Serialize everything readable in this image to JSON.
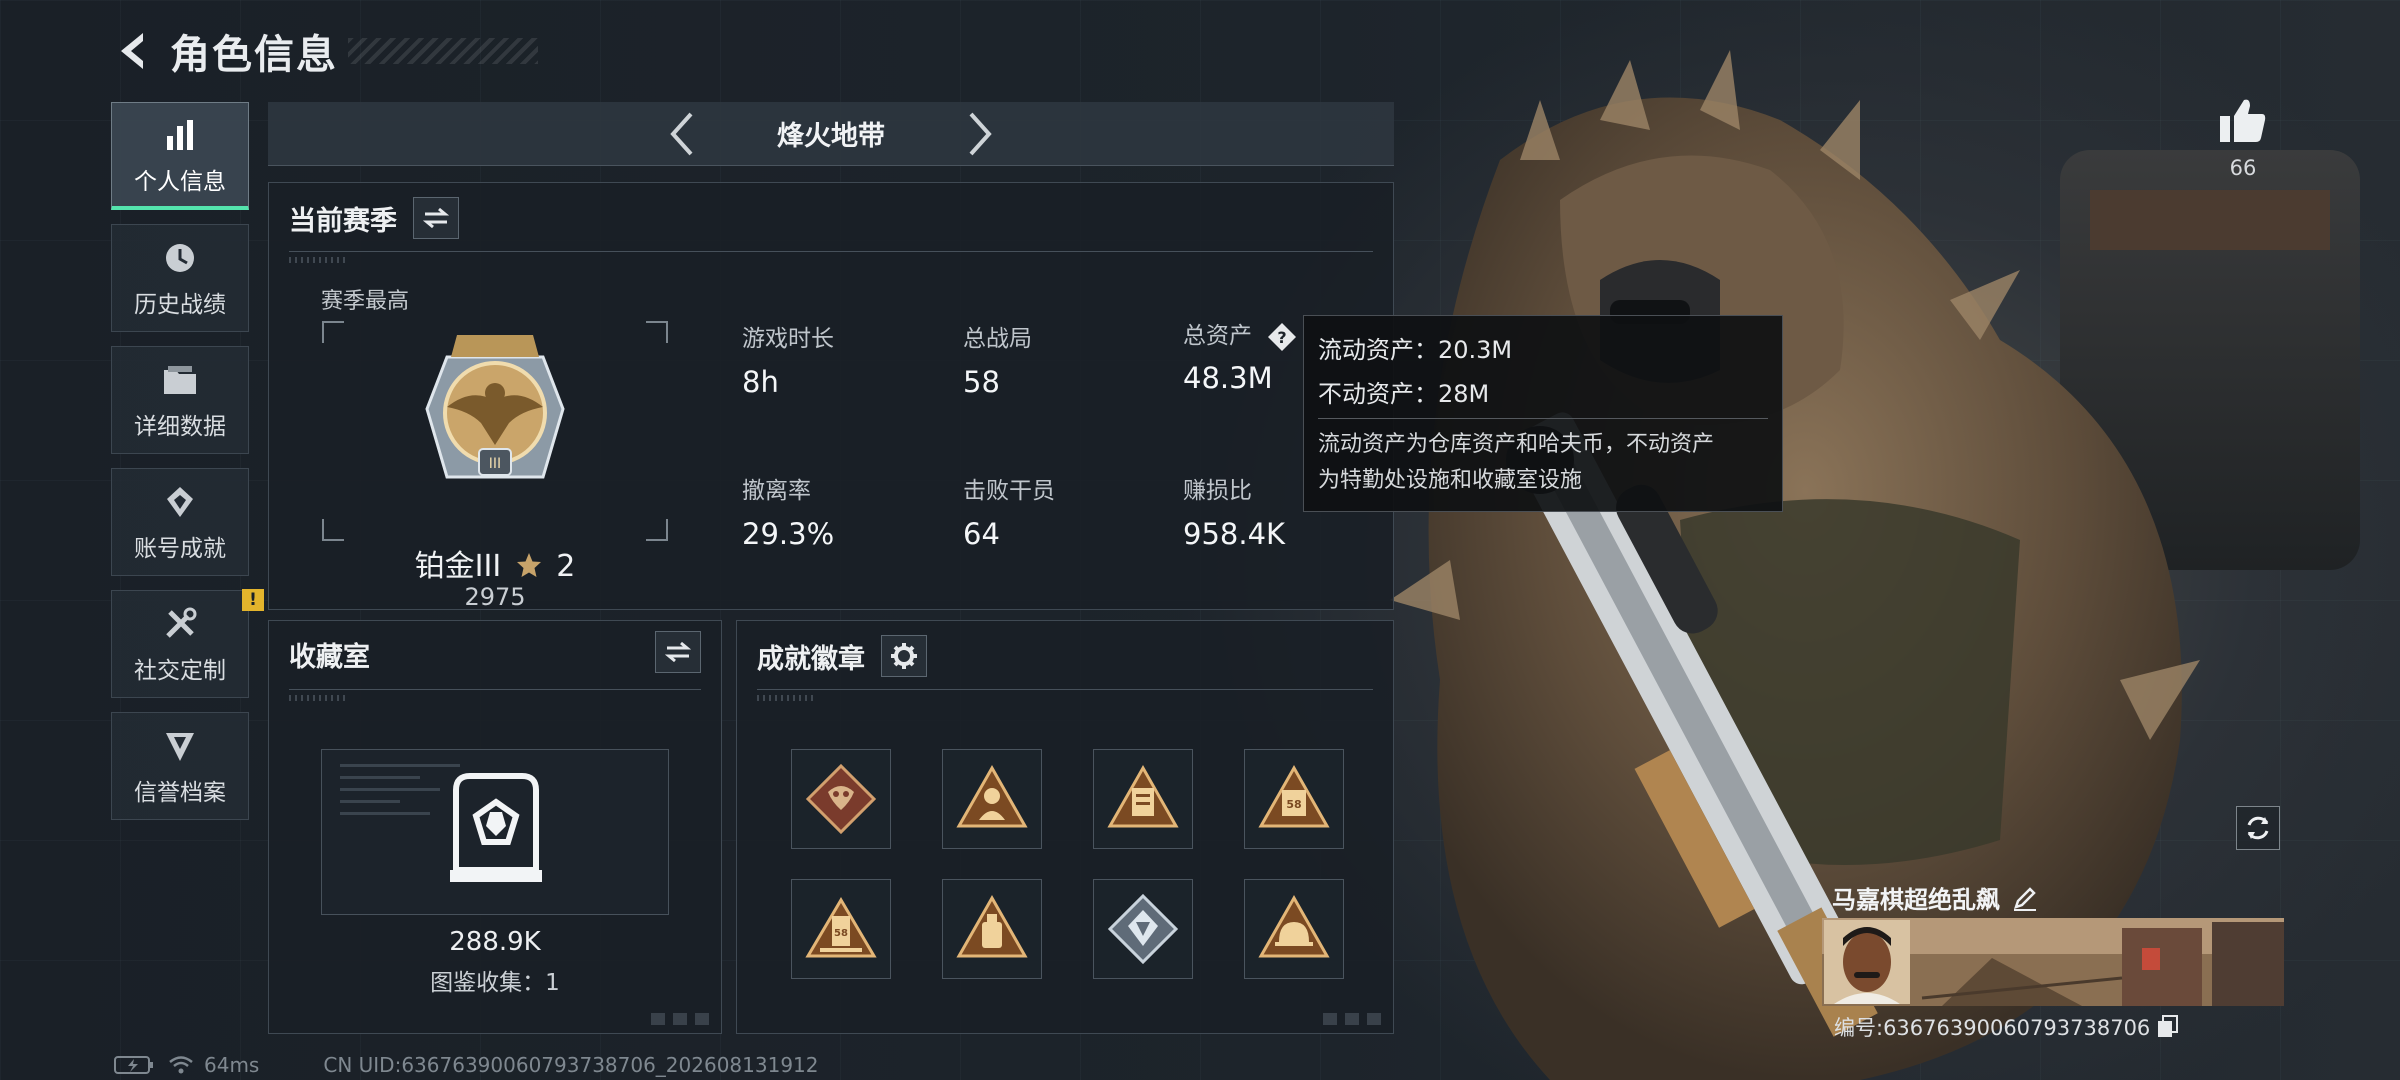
{
  "header": {
    "title": "角色信息"
  },
  "sidebar": {
    "items": [
      {
        "label": "个人信息",
        "active": true
      },
      {
        "label": "历史战绩"
      },
      {
        "label": "详细数据"
      },
      {
        "label": "账号成就"
      },
      {
        "label": "社交定制",
        "notice": "!"
      },
      {
        "label": "信誉档案"
      }
    ]
  },
  "mode_nav": {
    "current": "烽火地带"
  },
  "season": {
    "title": "当前赛季",
    "best_label": "赛季最高",
    "rank_name": "铂金III",
    "rank_stars": "2",
    "rank_score": "2975",
    "stats": [
      {
        "label": "游戏时长",
        "value": "8h"
      },
      {
        "label": "总战局",
        "value": "58"
      },
      {
        "label": "总资产",
        "value": "48.3M"
      },
      {
        "label": "撤离率",
        "value": "29.3%"
      },
      {
        "label": "击败干员",
        "value": "64"
      },
      {
        "label": "赚损比",
        "value": "958.4K"
      }
    ]
  },
  "tooltip": {
    "liquid": "流动资产：20.3M",
    "fixed": "不动资产：28M",
    "desc_line1": "流动资产为仓库资产和哈夫币，不动资产",
    "desc_line2": "为特勤处设施和收藏室设施"
  },
  "collection": {
    "title": "收藏室",
    "value": "288.9K",
    "count_text": "图鉴收集：1"
  },
  "achievements": {
    "title": "成就徽章",
    "badge_count": 8
  },
  "profile": {
    "likes": "66",
    "player_name": "马嘉棋超绝乱飙",
    "player_id": "编号:6367639006079373870​6"
  },
  "footer": {
    "ping": "64ms",
    "uid": "CN UID:6367639006079373870​6_202608131912"
  },
  "colors": {
    "accent": "#54e4ad",
    "notice": "#e3b42c",
    "gold": "#c7a36a"
  }
}
